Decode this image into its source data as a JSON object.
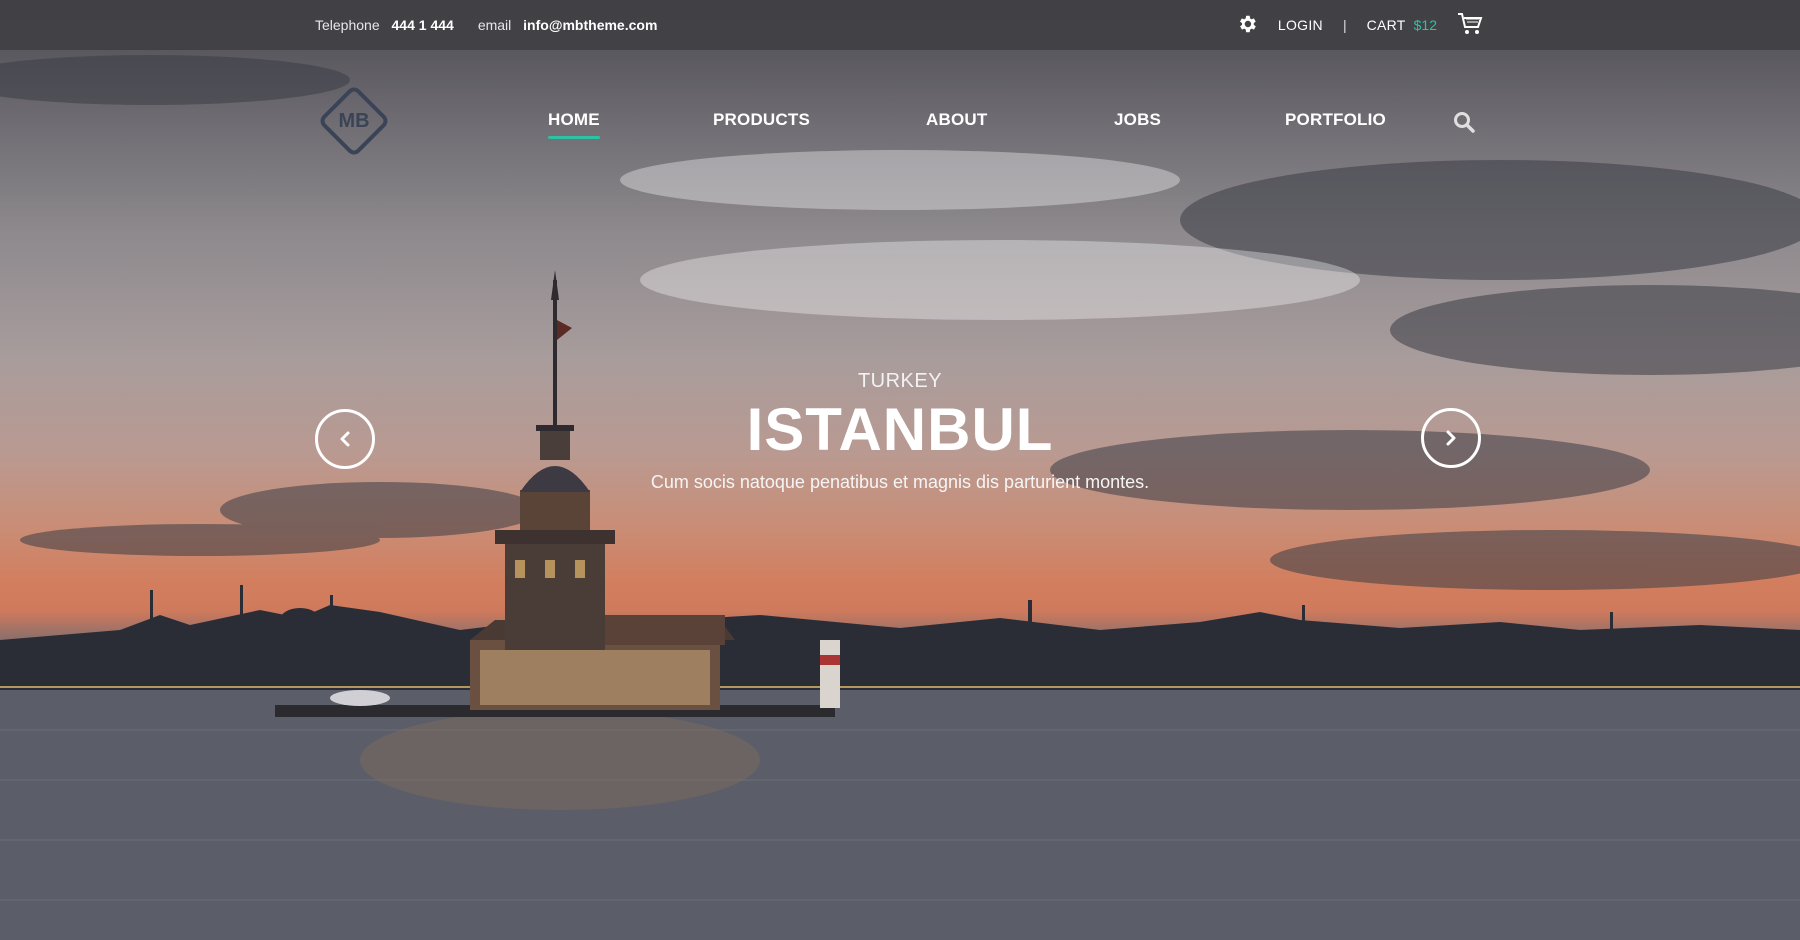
{
  "topbar": {
    "telephone_label": "Telephone",
    "telephone_value": "444 1 444",
    "email_label": "email",
    "email_value": "info@mbtheme.com",
    "login": "LOGIN",
    "separator": "|",
    "cart_label": "CART",
    "cart_price": "$12",
    "icons": [
      "gear-icon",
      "cart-icon"
    ]
  },
  "logo": {
    "text": "MB"
  },
  "nav": {
    "items": [
      {
        "label": "HOME",
        "active": true
      },
      {
        "label": "PRODUCTS",
        "active": false
      },
      {
        "label": "ABOUT",
        "active": false
      },
      {
        "label": "JOBS",
        "active": false
      },
      {
        "label": "PORTFOLIO",
        "active": false
      }
    ],
    "search_icon": "search-icon"
  },
  "slide": {
    "subtitle": "TURKEY",
    "title": "ISTANBUL",
    "description": "Cum socis natoque penatibus et magnis dis parturient montes."
  },
  "slider_controls": {
    "prev_icon": "chevron-left-icon",
    "next_icon": "chevron-right-icon"
  },
  "colors": {
    "accent": "#2fc1a3",
    "logo": "#3a4456",
    "topbar_bg": "#404044"
  }
}
